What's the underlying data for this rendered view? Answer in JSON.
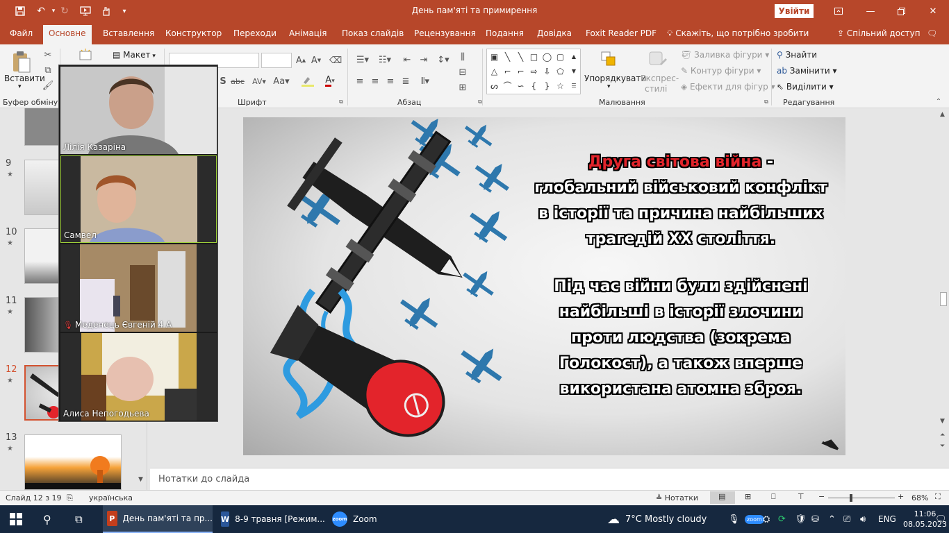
{
  "titlebar": {
    "title": "День пам'яті та примирення",
    "signin": "Увійти",
    "icons": [
      "save-icon",
      "undo-icon",
      "redo-icon",
      "present-from-start-icon",
      "touch-mode-icon",
      "customize-icon"
    ]
  },
  "tabs": {
    "file": "Файл",
    "home": "Основне",
    "insert": "Вставлення",
    "design": "Конструктор",
    "transitions": "Переходи",
    "animations": "Анімація",
    "slideshow": "Показ слайдів",
    "review": "Рецензування",
    "view": "Подання",
    "help": "Довідка",
    "foxit": "Foxit Reader PDF",
    "tellme": "Скажіть, що потрібно зробити",
    "share": "Спільний доступ"
  },
  "ribbon": {
    "paste": "Вставити",
    "clipboard": "Буфер обміну",
    "layout": "Макет",
    "font": "Шрифт",
    "paragraph": "Абзац",
    "arrange": "Упорядкувати",
    "quickstyles_1": "Експрес-",
    "quickstyles_2": "стилі",
    "shape_fill": "Заливка фігури",
    "shape_outline": "Контур фігури",
    "shape_effects": "Ефекти для фігур",
    "drawing": "Малювання",
    "find": "Знайти",
    "replace": "Замінити",
    "select": "Виділити",
    "editing": "Редагування"
  },
  "thumbnails": [
    {
      "num": "9",
      "star": "★"
    },
    {
      "num": "10",
      "star": "★"
    },
    {
      "num": "11",
      "star": "★"
    },
    {
      "num": "12",
      "star": "★"
    },
    {
      "num": "13",
      "star": "★"
    }
  ],
  "zoom": {
    "participants": [
      {
        "name": "Лілія Казаріна"
      },
      {
        "name": "Самвел"
      },
      {
        "name": "Меденець Євгеній 4 А",
        "muted": true
      },
      {
        "name": "Алиса Непогодьева"
      }
    ]
  },
  "slide": {
    "title_red": "Друга світова війна",
    "title_dash": " -",
    "line2": "глобальний військовий конфлікт",
    "line3": "в історії та причина найбільших",
    "line4": "трагедій ХХ століття.",
    "para2_1": "Під час війни були здійснені",
    "para2_2": "найбільші  в історії злочини",
    "para2_3": "проти людства (зокрема",
    "para2_4": "Голокост), а також вперше",
    "para2_5": "використана атомна зброя.",
    "colors": {
      "red": "#e3242b",
      "blue_planes": "#2e78ad",
      "bomb_red": "#e3242b"
    }
  },
  "notes": {
    "placeholder": "Нотатки до слайда"
  },
  "status": {
    "slide_counter": "Слайд 12 з 19",
    "language": "українська",
    "notes_btn": "Нотатки",
    "zoom": "68%",
    "zoom_level": 0.68
  },
  "taskbar": {
    "apps": [
      {
        "label": "День пам'яті та пр...",
        "icon": "P"
      },
      {
        "label": "8-9 травня [Режим...",
        "icon": "W"
      },
      {
        "label": "Zoom",
        "icon": "zoom"
      }
    ],
    "weather": "7°C  Mostly cloudy",
    "lang": "ENG",
    "time": "11:06",
    "date": "08.05.2023"
  }
}
